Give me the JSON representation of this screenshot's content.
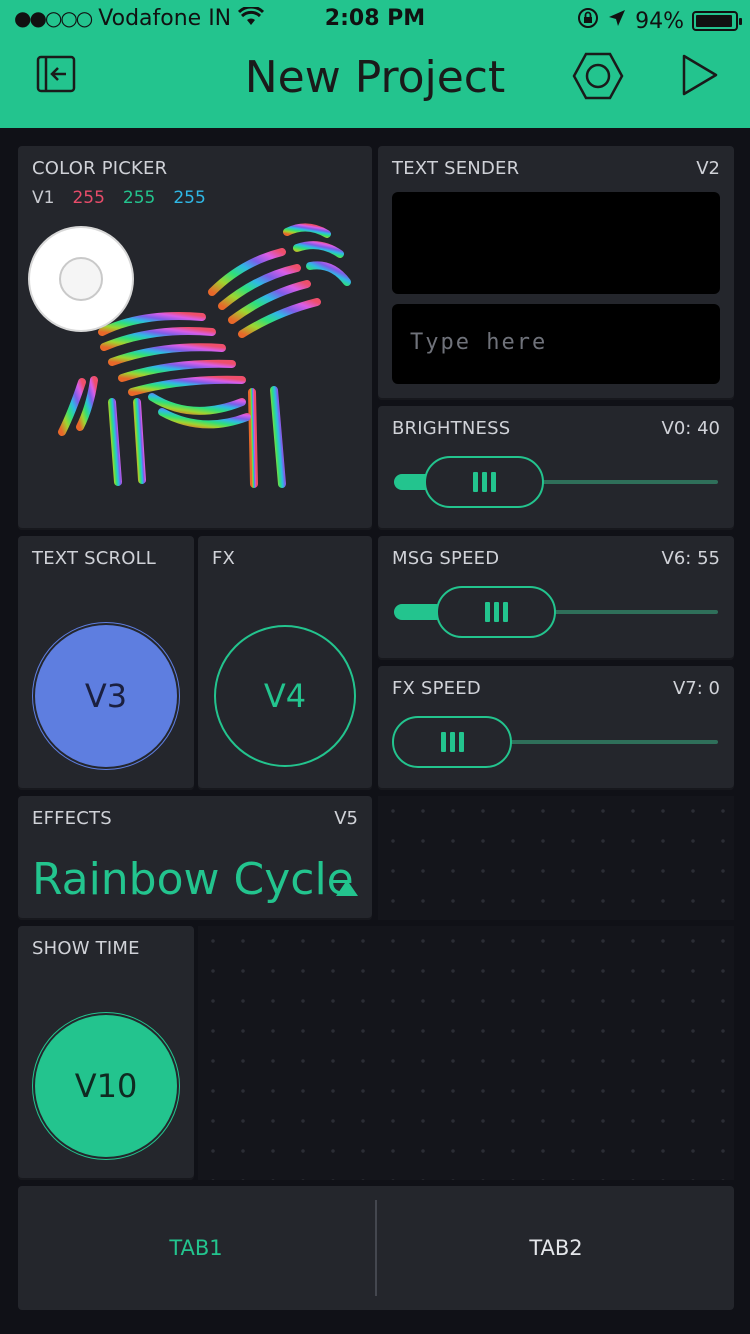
{
  "status_bar": {
    "signal_dots": "●●○○○",
    "carrier": "Vodafone IN",
    "wifi": "wifi-icon",
    "time": "2:08 PM",
    "battery_percent": "94%",
    "battery_level": 0.94
  },
  "app_bar": {
    "title": "New Project",
    "icons": [
      "exit-icon",
      "settings-hexagon-icon",
      "play-icon"
    ]
  },
  "colors": {
    "accent": "#23c48e",
    "blue": "#5e7ee0",
    "red": "#e84c6a",
    "cyan": "#2fb8e6"
  },
  "widgets": {
    "color_picker": {
      "title": "COLOR PICKER",
      "pin": "V1",
      "r": "255",
      "g": "255",
      "b": "255"
    },
    "text_sender": {
      "title": "TEXT SENDER",
      "pin": "V2",
      "placeholder": "Type here"
    },
    "brightness": {
      "title": "BRIGHTNESS",
      "pin_value": "V0: 40",
      "value": 40
    },
    "msg_speed": {
      "title": "MSG SPEED",
      "pin_value": "V6: 55",
      "value": 55
    },
    "fx_speed": {
      "title": "FX SPEED",
      "pin_value": "V7: 0",
      "value": 0
    },
    "text_scroll": {
      "title": "TEXT SCROLL",
      "button_label": "V3",
      "state": "on"
    },
    "fx": {
      "title": "FX",
      "button_label": "V4",
      "state": "off"
    },
    "effects": {
      "title": "EFFECTS",
      "pin": "V5",
      "selected": "Rainbow Cycle"
    },
    "show_time": {
      "title": "SHOW TIME",
      "button_label": "V10",
      "state": "on"
    }
  },
  "tabs": [
    {
      "label": "TAB1",
      "active": true
    },
    {
      "label": "TAB2",
      "active": false
    }
  ]
}
